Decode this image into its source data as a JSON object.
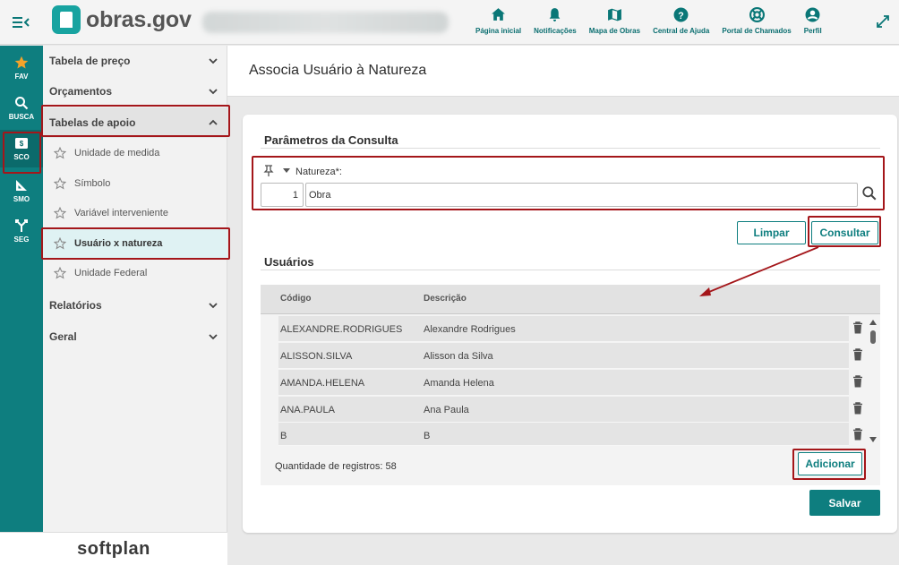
{
  "header": {
    "brand": "obras.gov",
    "nav": [
      {
        "label": "Página inicial",
        "icon": "home-icon"
      },
      {
        "label": "Notificações",
        "icon": "bell-icon"
      },
      {
        "label": "Mapa de Obras",
        "icon": "map-icon"
      },
      {
        "label": "Central de Ajuda",
        "icon": "help-icon"
      },
      {
        "label": "Portal de Chamados",
        "icon": "lifebuoy-icon"
      },
      {
        "label": "Perfil",
        "icon": "user-icon"
      }
    ]
  },
  "rail": {
    "items": [
      {
        "label": "FAV",
        "icon": "star-icon"
      },
      {
        "label": "BUSCA",
        "icon": "search-icon"
      },
      {
        "label": "SCO",
        "icon": "module-icon"
      },
      {
        "label": "SMO",
        "icon": "ruler-icon"
      },
      {
        "label": "SEG",
        "icon": "merge-icon"
      }
    ],
    "footer": "softplan"
  },
  "subnav": {
    "sections": [
      {
        "label": "Tabela de preço"
      },
      {
        "label": "Orçamentos"
      },
      {
        "label": "Tabelas de apoio"
      },
      {
        "label": "Relatórios"
      },
      {
        "label": "Geral"
      }
    ],
    "items": [
      {
        "label": "Unidade de medida"
      },
      {
        "label": "Símbolo"
      },
      {
        "label": "Variável interveniente"
      },
      {
        "label": "Usuário x natureza"
      },
      {
        "label": "Unidade Federal"
      }
    ]
  },
  "page": {
    "title": "Associa Usuário à Natureza",
    "params_title": "Parâmetros da Consulta",
    "field_label": "Natureza*:",
    "field_code": "1",
    "field_value": "Obra",
    "clear_label": "Limpar",
    "query_label": "Consultar",
    "users_title": "Usuários",
    "columns": [
      "Código",
      "Descrição"
    ],
    "rows": [
      {
        "code": "ALEXANDRE.RODRIGUES",
        "desc": "Alexandre Rodrigues"
      },
      {
        "code": "ALISSON.SILVA",
        "desc": "Alisson da Silva"
      },
      {
        "code": "AMANDA.HELENA",
        "desc": "Amanda Helena"
      },
      {
        "code": "ANA.PAULA",
        "desc": "Ana Paula"
      },
      {
        "code": "B",
        "desc": "B"
      }
    ],
    "count_label": "Quantidade de registros: 58",
    "add_label": "Adicionar",
    "save_label": "Salvar"
  },
  "colors": {
    "accent": "#0e7e7f",
    "highlight": "#a4161a"
  }
}
